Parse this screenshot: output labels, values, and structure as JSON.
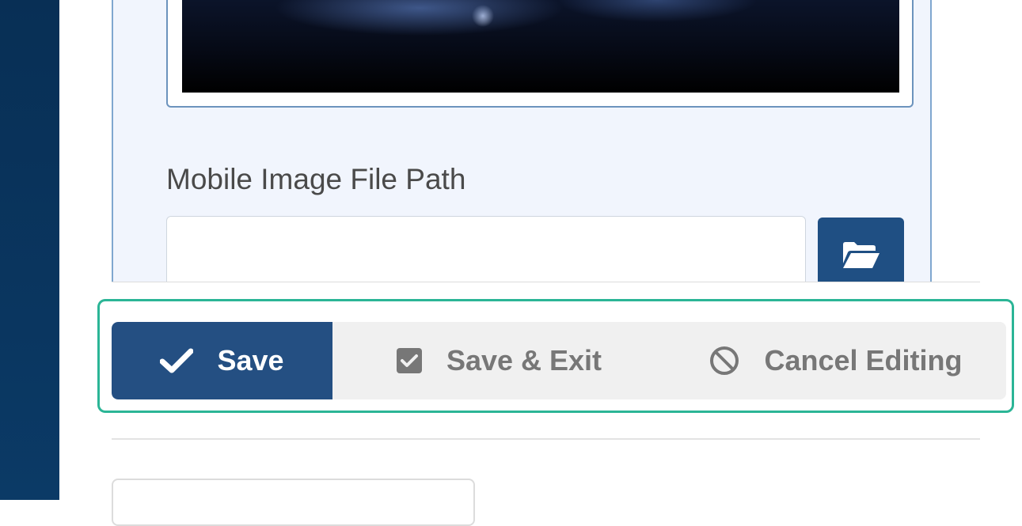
{
  "panel": {
    "field_label": "Mobile Image File Path",
    "path_value": "",
    "browse_icon": "folder-open-icon",
    "dropdown_icon": "caret-down-icon"
  },
  "actions": {
    "save_label": "Save",
    "save_icon": "check-icon",
    "save_exit_label": "Save & Exit",
    "save_exit_icon": "checkbox-checked-icon",
    "cancel_label": "Cancel Editing",
    "cancel_icon": "ban-icon"
  },
  "colors": {
    "left_rail": "#0b3a66",
    "primary": "#244f82",
    "highlight": "#2bb596",
    "muted_text": "#777777"
  }
}
